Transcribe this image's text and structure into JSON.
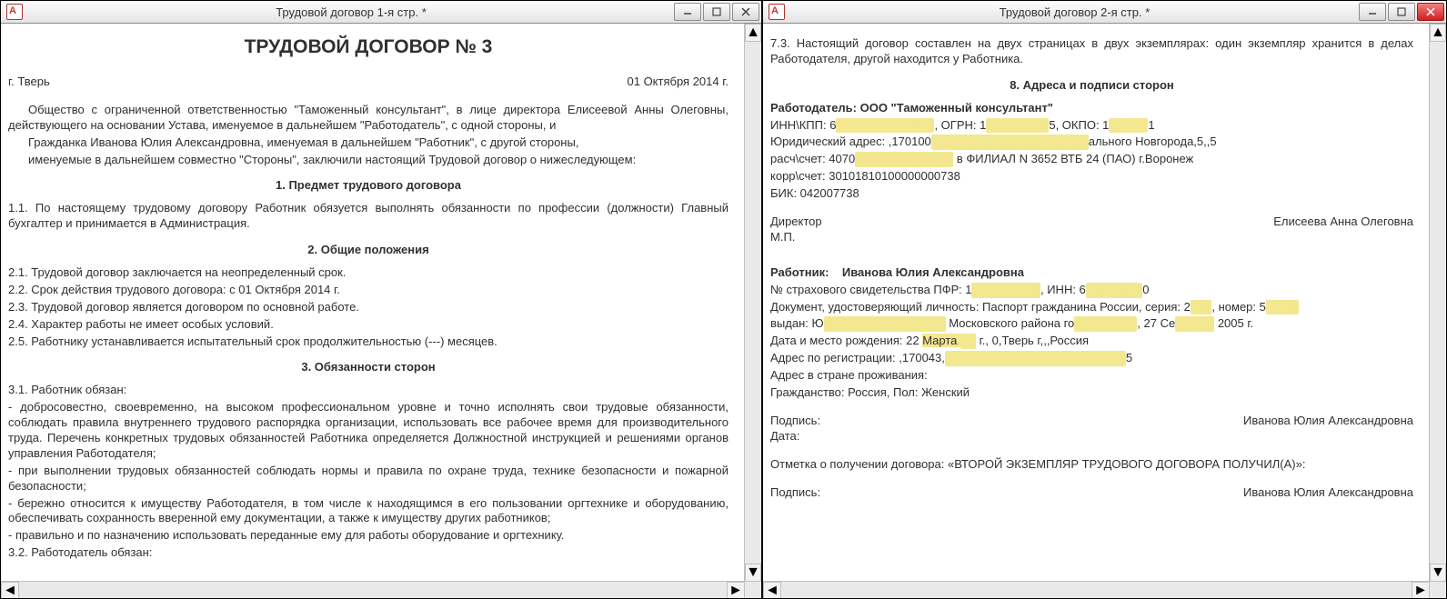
{
  "left": {
    "title": "Трудовой договор 1-я стр. *",
    "doc_title": "ТРУДОВОЙ ДОГОВОР № 3",
    "city": "г. Тверь",
    "date": "01 Октября 2014 г.",
    "intro1": "Общество с ограниченной ответственностью \"Таможенный консультант\", в лице директора Елисеевой Анны Олеговны, действующего на основании Устава, именуемое в дальнейшем \"Работодатель\", с одной стороны, и",
    "intro2": "Гражданка Иванова Юлия Александровна, именуемая в дальнейшем \"Работник\", с другой стороны,",
    "intro3": "именуемые в дальнейшем совместно \"Стороны\", заключили настоящий Трудовой договор о нижеследующем:",
    "s1_title": "1. Предмет трудового договора",
    "s1_1": "1.1. По настоящему трудовому договору Работник обязуется выполнять обязанности по профессии (должности) Главный бухгалтер и принимается в Администрация.",
    "s2_title": "2. Общие положения",
    "s2_1": "2.1. Трудовой договор заключается на неопределенный срок.",
    "s2_2": "2.2. Срок действия трудового договора: с 01 Октября 2014 г.",
    "s2_3": "2.3. Трудовой договор является договором по основной работе.",
    "s2_4": "2.4. Характер работы не имеет особых условий.",
    "s2_5": "2.5. Работнику устанавливается испытательный срок продолжительностью (---) месяцев.",
    "s3_title": "3. Обязанности сторон",
    "s3_1": "3.1. Работник обязан:",
    "s3_b1": "- добросовестно, своевременно, на высоком профессиональном уровне и точно исполнять свои трудовые обязанности, соблюдать правила внутреннего трудового распорядка  организации, использовать все рабочее время для производительного труда. Перечень конкретных трудовых обязанностей Работника определяется Должностной инструкцией и решениями органов управления Работодателя;",
    "s3_b2": "- при  выполнении трудовых обязанностей соблюдать нормы и правила по охране труда, технике безопасности и пожарной безопасности;",
    "s3_b3": "- бережно  относится к имуществу Работодателя, в том числе к находящимся в его пользовании оргтехнике и оборудованию, обеспечивать сохранность вверенной  ему  документации, а также к имуществу других работников;",
    "s3_b4": "- правильно и по назначению использовать переданные ему для работы оборудование и оргтехнику.",
    "s3_2": "3.2. Работодатель обязан:"
  },
  "right": {
    "title": "Трудовой договор 2-я стр. *",
    "p73": "7.3. Настоящий договор составлен на двух страницах в двух экземплярах: один экземпляр хранится в делах Работодателя, другой находится у Работника.",
    "s8_title": "8. Адреса и подписи сторон",
    "employer_head": "Работодатель: ООО \"Таможенный консультант\"",
    "innkpp_label": "ИНН\\КПП: 6",
    "ogrn_label": ",  ОГРН: 1",
    "okpo_label": "5,  ОКПО: 1",
    "okpo_tail": "1",
    "legaddr_label": "Юридический адрес: ,170100",
    "legaddr_tail": "ального Новгорода,5,,5",
    "rs_label": "расч\\счет: 4070",
    "rs_tail": " в ФИЛИАЛ N 3652 ВТБ 24 (ПАО) г.Воронеж",
    "ks": "корр\\счет: 30101810100000000738",
    "bik": "БИК: 042007738",
    "director_label": "Директор",
    "director_name": "Елисеева Анна Олеговна",
    "mp": "М.П.",
    "worker_label": "Работник:",
    "worker_name": "Иванова Юлия Александровна",
    "pfr_label": "№ страхового свидетельства ПФР: 1",
    "inn2_label": ", ИНН: 6",
    "inn2_tail": "0",
    "doc_label": "Документ, удостоверяющий личность: Паспорт гражданина России, серия: 2",
    "doc_num_label": ", номер: 5",
    "issued_label": "выдан: Ю",
    "issued_mid": " Московского района го",
    "issued_date": ", 27 Се",
    "issued_year": " 2005 г.",
    "birth_label": "Дата и место рождения: 22 ",
    "birth_mid": "Марта ",
    "birth_tail": " г., 0,Тверь г,,,Россия",
    "regaddr_label": "Адрес по регистрации: ,170043,",
    "regaddr_tail": "5",
    "liveaddr": "Адрес в стране проживания:",
    "citizen": "Гражданство: Россия, Пол: Женский",
    "sig_label": "Подпись:",
    "sig_name": "Иванова Юлия Александровна",
    "date_label": "Дата:",
    "receipt": "Отметка о получении договора: «ВТОРОЙ ЭКЗЕМПЛЯР ТРУДОВОГО ДОГОВОРА ПОЛУЧИЛ(А)»:",
    "sig2_label": "Подпись:",
    "sig2_name": "Иванова Юлия Александровна"
  }
}
